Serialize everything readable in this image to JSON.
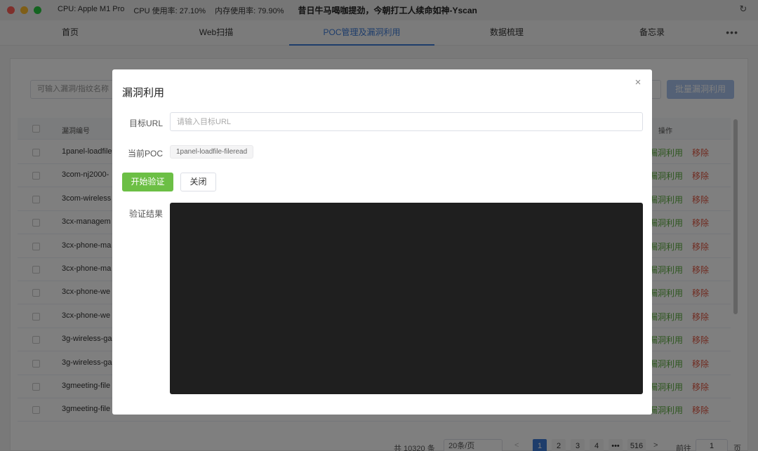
{
  "titlebar": {
    "cpu_model": "CPU: Apple M1 Pro",
    "cpu_usage": "CPU 使用率: 27.10%",
    "mem_usage": "内存使用率: 79.90%",
    "slogan": "昔日牛马喝咖提劲，今朝打工人续命如神-Yscan",
    "reload_icon": "↻"
  },
  "nav": {
    "items": [
      {
        "label": "首页"
      },
      {
        "label": "Web扫描"
      },
      {
        "label": "POC管理及漏洞利用"
      },
      {
        "label": "数据梳理"
      },
      {
        "label": "备忘录"
      }
    ],
    "active_index": 2,
    "more_icon": "•••"
  },
  "toolbar": {
    "search_placeholder": "可输入漏洞/指纹名称",
    "batch_button": "批量漏洞利用"
  },
  "table": {
    "columns": {
      "id": "漏洞编号",
      "actions": "操作"
    },
    "rows": [
      {
        "id": "1panel-loadfile",
        "exploit": "漏洞利用",
        "remove": "移除"
      },
      {
        "id": "3com-nj2000-",
        "exploit": "漏洞利用",
        "remove": "移除"
      },
      {
        "id": "3com-wireless",
        "exploit": "漏洞利用",
        "remove": "移除"
      },
      {
        "id": "3cx-managem",
        "exploit": "漏洞利用",
        "remove": "移除"
      },
      {
        "id": "3cx-phone-ma",
        "exploit": "漏洞利用",
        "remove": "移除"
      },
      {
        "id": "3cx-phone-ma",
        "exploit": "漏洞利用",
        "remove": "移除"
      },
      {
        "id": "3cx-phone-we",
        "exploit": "漏洞利用",
        "remove": "移除"
      },
      {
        "id": "3cx-phone-we",
        "exploit": "漏洞利用",
        "remove": "移除"
      },
      {
        "id": "3g-wireless-ga",
        "exploit": "漏洞利用",
        "remove": "移除"
      },
      {
        "id": "3g-wireless-ga",
        "exploit": "漏洞利用",
        "remove": "移除"
      },
      {
        "id": "3gmeeting-file",
        "exploit": "漏洞利用",
        "remove": "移除"
      },
      {
        "id": "3gmeeting-file",
        "exploit": "漏洞利用",
        "remove": "移除"
      }
    ]
  },
  "pagination": {
    "total": "共 10320 条",
    "page_size": "20条/页",
    "prev": "<",
    "pages": [
      "1",
      "2",
      "3",
      "4",
      "•••",
      "516"
    ],
    "current": "1",
    "next": ">",
    "goto_label": "前往",
    "goto_value": "1",
    "page_label": "页"
  },
  "dialog": {
    "title": "漏洞利用",
    "close_icon": "×",
    "target_url_label": "目标URL",
    "target_url_placeholder": "请输入目标URL",
    "target_url_value": "",
    "current_poc_label": "当前POC",
    "current_poc_value": "1panel-loadfile-fileread",
    "start_button": "开始验证",
    "close_button": "关闭",
    "result_label": "验证结果",
    "result_text": ""
  },
  "colors": {
    "accent": "#3d7ad6",
    "success": "#6cbf45",
    "danger": "#e0553f",
    "result_bg": "#1f1f1f"
  }
}
